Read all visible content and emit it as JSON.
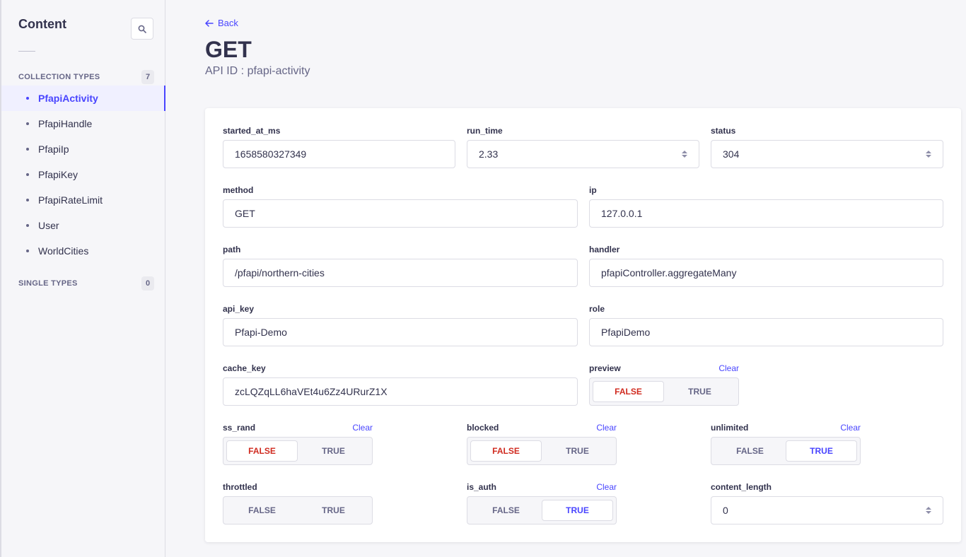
{
  "sidebar": {
    "title": "Content",
    "collection_types_label": "COLLECTION TYPES",
    "collection_types_count": "7",
    "items": [
      {
        "label": "PfapiActivity"
      },
      {
        "label": "PfapiHandle"
      },
      {
        "label": "PfapiIp"
      },
      {
        "label": "PfapiKey"
      },
      {
        "label": "PfapiRateLimit"
      },
      {
        "label": "User"
      },
      {
        "label": "WorldCities"
      }
    ],
    "single_types_label": "SINGLE TYPES",
    "single_types_count": "0"
  },
  "header": {
    "back_label": "Back",
    "title": "GET",
    "api_id": "API ID : pfapi-activity"
  },
  "form": {
    "started_at_ms": {
      "label": "started_at_ms",
      "value": "1658580327349"
    },
    "run_time": {
      "label": "run_time",
      "value": "2.33"
    },
    "status": {
      "label": "status",
      "value": "304"
    },
    "method": {
      "label": "method",
      "value": "GET"
    },
    "ip": {
      "label": "ip",
      "value": "127.0.0.1"
    },
    "path": {
      "label": "path",
      "value": "/pfapi/northern-cities"
    },
    "handler": {
      "label": "handler",
      "value": "pfapiController.aggregateMany"
    },
    "api_key": {
      "label": "api_key",
      "value": "Pfapi-Demo"
    },
    "role": {
      "label": "role",
      "value": "PfapiDemo"
    },
    "cache_key": {
      "label": "cache_key",
      "value": "zcLQZqLL6haVEt4u6Zz4URurZ1X"
    },
    "preview": {
      "label": "preview",
      "clear": "Clear",
      "false": "FALSE",
      "true": "TRUE",
      "selected": "false"
    },
    "ss_rand": {
      "label": "ss_rand",
      "clear": "Clear",
      "false": "FALSE",
      "true": "TRUE",
      "selected": "false"
    },
    "blocked": {
      "label": "blocked",
      "clear": "Clear",
      "false": "FALSE",
      "true": "TRUE",
      "selected": "false"
    },
    "unlimited": {
      "label": "unlimited",
      "clear": "Clear",
      "false": "FALSE",
      "true": "TRUE",
      "selected": "true"
    },
    "throttled": {
      "label": "throttled",
      "false": "FALSE",
      "true": "TRUE",
      "selected": "none"
    },
    "is_auth": {
      "label": "is_auth",
      "clear": "Clear",
      "false": "FALSE",
      "true": "TRUE",
      "selected": "true"
    },
    "content_length": {
      "label": "content_length",
      "value": "0"
    }
  },
  "colors": {
    "accent": "#4945ff",
    "danger": "#d02b20",
    "text": "#32324d",
    "muted": "#666687"
  }
}
